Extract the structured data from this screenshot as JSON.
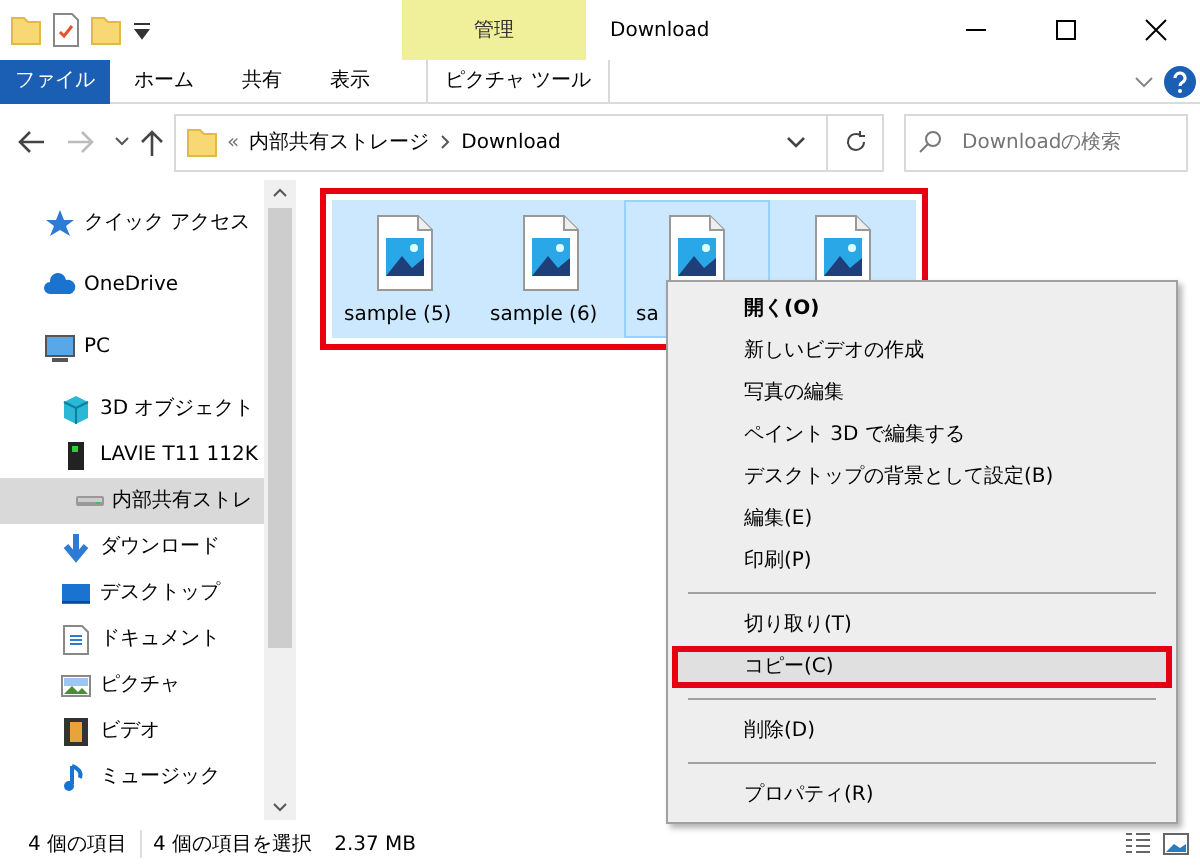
{
  "window": {
    "title": "Download",
    "context_tab": "管理"
  },
  "ribbon_tabs": [
    {
      "label": "ファイル",
      "kind": "file"
    },
    {
      "label": "ホーム",
      "kind": "tab"
    },
    {
      "label": "共有",
      "kind": "tab"
    },
    {
      "label": "表示",
      "kind": "tab"
    },
    {
      "label": "ピクチャ ツール",
      "kind": "context"
    }
  ],
  "address": {
    "overflow": "«",
    "path": [
      "内部共有ストレージ",
      "Download"
    ]
  },
  "search": {
    "placeholder": "Downloadの検索"
  },
  "sidebar": {
    "items": [
      {
        "label": "クイック アクセス",
        "selected": false
      },
      {
        "label": "OneDrive",
        "selected": false
      },
      {
        "label": "PC",
        "selected": false,
        "children": [
          {
            "label": "3D オブジェクト",
            "selected": false
          },
          {
            "label": "LAVIE T11 112K",
            "selected": false,
            "children": [
              {
                "label": "内部共有ストレ",
                "selected": true
              }
            ]
          },
          {
            "label": "ダウンロード",
            "selected": false
          },
          {
            "label": "デスクトップ",
            "selected": false
          },
          {
            "label": "ドキュメント",
            "selected": false
          },
          {
            "label": "ピクチャ",
            "selected": false
          },
          {
            "label": "ビデオ",
            "selected": false
          },
          {
            "label": "ミュージック",
            "selected": false
          }
        ]
      }
    ]
  },
  "files": {
    "annotated": true,
    "items": [
      {
        "name": "sample (5)",
        "selected": true,
        "focused": false
      },
      {
        "name": "sample (6)",
        "selected": true,
        "focused": false
      },
      {
        "name": "sa",
        "selected": true,
        "focused": true
      },
      {
        "selected": true,
        "focused": false
      }
    ]
  },
  "context_menu": [
    {
      "kind": "item",
      "label": "開く(O)",
      "default": true,
      "selected": false,
      "annotated": false
    },
    {
      "kind": "item",
      "label": "新しいビデオの作成",
      "default": false,
      "selected": false,
      "annotated": false
    },
    {
      "kind": "item",
      "label": "写真の編集",
      "default": false,
      "selected": false,
      "annotated": false
    },
    {
      "kind": "item",
      "label": "ペイント 3D で編集する",
      "default": false,
      "selected": false,
      "annotated": false
    },
    {
      "kind": "item",
      "label": "デスクトップの背景として設定(B)",
      "default": false,
      "selected": false,
      "annotated": false
    },
    {
      "kind": "item",
      "label": "編集(E)",
      "default": false,
      "selected": false,
      "annotated": false
    },
    {
      "kind": "item",
      "label": "印刷(P)",
      "default": false,
      "selected": false,
      "annotated": false
    },
    {
      "kind": "separator"
    },
    {
      "kind": "item",
      "label": "切り取り(T)",
      "default": false,
      "selected": false,
      "annotated": false
    },
    {
      "kind": "item",
      "label": "コピー(C)",
      "default": false,
      "selected": true,
      "annotated": true
    },
    {
      "kind": "separator"
    },
    {
      "kind": "item",
      "label": "削除(D)",
      "default": false,
      "selected": false,
      "annotated": false
    },
    {
      "kind": "separator"
    },
    {
      "kind": "item",
      "label": "プロパティ(R)",
      "default": false,
      "selected": false,
      "annotated": false
    }
  ],
  "status_bar": {
    "count": "4 個の項目",
    "selection": "4 個の項目を選択",
    "size": "2.37 MB"
  }
}
